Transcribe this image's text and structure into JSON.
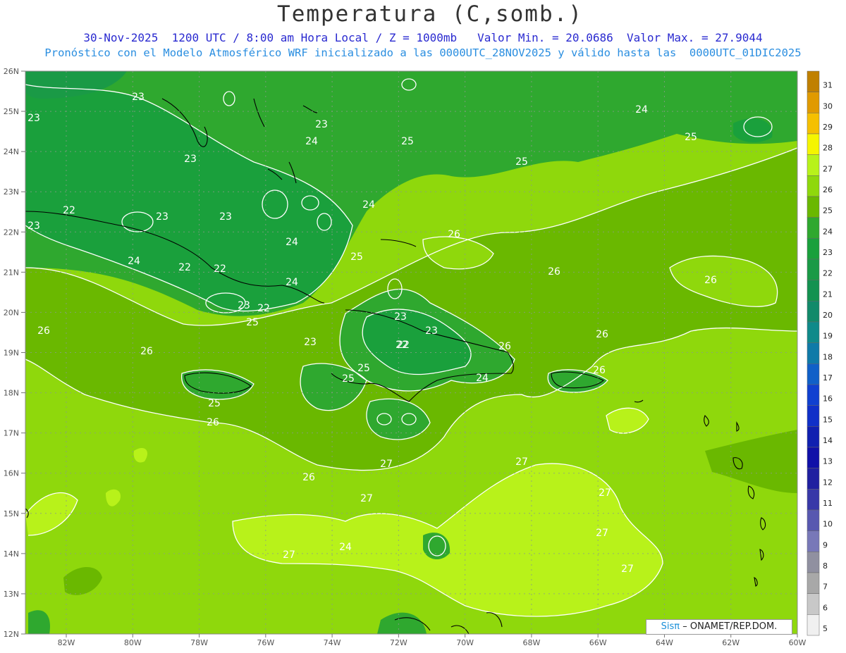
{
  "header": {
    "title": "Temperatura (C,somb.)",
    "line1": "30-Nov-2025  1200 UTC / 8:00 am Hora Local / Z = 1000mb   Valor Min. = 20.0686  Valor Max. = 27.9044",
    "line2": "Pronóstico con el Modelo Atmosférico WRF inicializado a las 0000UTC_28NOV2025 y válido hasta las  0000UTC_01DIC2025"
  },
  "axes": {
    "lat_labels": [
      "26N",
      "25N",
      "24N",
      "23N",
      "22N",
      "21N",
      "20N",
      "19N",
      "18N",
      "17N",
      "16N",
      "15N",
      "14N",
      "13N",
      "12N"
    ],
    "lon_labels": [
      "82W",
      "80W",
      "78W",
      "76W",
      "74W",
      "72W",
      "70W",
      "68W",
      "66W",
      "64W",
      "62W",
      "60W"
    ]
  },
  "colorbar": {
    "labels": [
      "31",
      "30",
      "29",
      "28",
      "27",
      "26",
      "25",
      "24",
      "23",
      "22",
      "21",
      "20",
      "19",
      "18",
      "17",
      "16",
      "15",
      "14",
      "13",
      "12",
      "11",
      "10",
      "9",
      "8",
      "7",
      "6",
      "5"
    ],
    "colors": [
      "#c08000",
      "#e09a00",
      "#f5c000",
      "#f5f500",
      "#b8f21a",
      "#8fd80c",
      "#6ab800",
      "#2fa82f",
      "#1aa03c",
      "#1a9a46",
      "#139250",
      "#128a6a",
      "#0f8a8a",
      "#0f7aa8",
      "#1060c8",
      "#1040d0",
      "#1030c8",
      "#1020b0",
      "#1010a8",
      "#2020a0",
      "#3838a8",
      "#5858b0",
      "#7878b8",
      "#9090a0",
      "#a8a8a8",
      "#c8c8c8",
      "#f0f0f0"
    ]
  },
  "contour_labels": [
    "23",
    "23",
    "23",
    "23",
    "23",
    "24",
    "24",
    "24",
    "24",
    "24",
    "25",
    "25",
    "25",
    "25",
    "25",
    "25",
    "25",
    "22",
    "22",
    "22",
    "22",
    "22",
    "23",
    "23",
    "23",
    "26",
    "26",
    "26",
    "26",
    "26",
    "26",
    "26",
    "26",
    "26",
    "26",
    "27",
    "27",
    "27",
    "27",
    "27",
    "27",
    "27",
    "24",
    "24",
    "23",
    "22",
    "23",
    "25",
    "24",
    "23"
  ],
  "credit": {
    "brand": "Sisπ",
    "text": "– ONAMET/REP.DOM."
  }
}
